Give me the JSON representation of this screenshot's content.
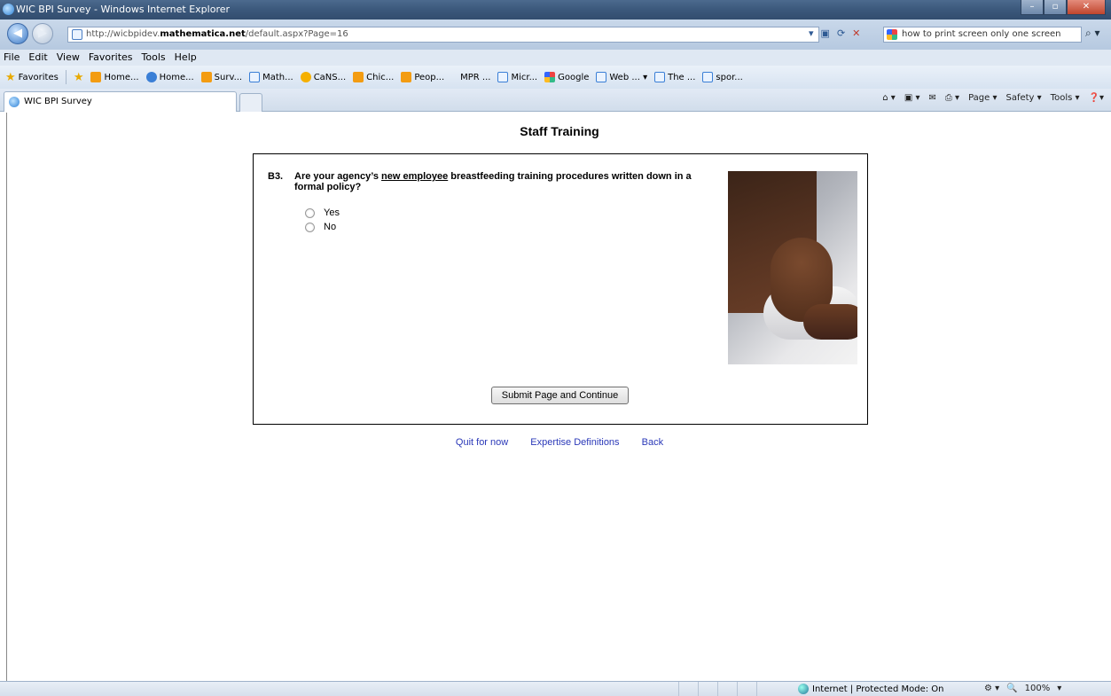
{
  "window": {
    "title": "WIC BPI Survey - Windows Internet Explorer",
    "controls": [
      "–",
      "▫",
      "✕"
    ]
  },
  "address": {
    "url_prefix": "http://wicbpidev.",
    "url_domain": "mathematica.net",
    "url_suffix": "/default.aspx?Page=16",
    "search_value": "how to print screen only one screen"
  },
  "menu": [
    "File",
    "Edit",
    "View",
    "Favorites",
    "Tools",
    "Help"
  ],
  "favorites": {
    "label": "Favorites",
    "items": [
      {
        "label": "Home...",
        "icon": "folder-icon"
      },
      {
        "label": "Home...",
        "icon": "globe-icon"
      },
      {
        "label": "Surv...",
        "icon": "folder-icon"
      },
      {
        "label": "Math...",
        "icon": "ie-page-icon"
      },
      {
        "label": "CaNS...",
        "icon": "ring-icon"
      },
      {
        "label": "Chic...",
        "icon": "folder-icon"
      },
      {
        "label": "Peop...",
        "icon": "folder-icon"
      },
      {
        "label": "MPR ...",
        "icon": "none"
      },
      {
        "label": "Micr...",
        "icon": "ie-page-icon"
      },
      {
        "label": "Google",
        "icon": "google-icon"
      },
      {
        "label": "Web ... ▾",
        "icon": "ie-page-icon"
      },
      {
        "label": "The ...",
        "icon": "ie-page-icon"
      },
      {
        "label": "spor...",
        "icon": "ie-page-icon"
      }
    ]
  },
  "tab": {
    "label": "WIC BPI Survey"
  },
  "commands": [
    "Page ▾",
    "Safety ▾",
    "Tools ▾"
  ],
  "page": {
    "title": "Staff Training",
    "question": {
      "number": "B3.",
      "text_before": "Are your agency’s ",
      "text_underlined": "new employee",
      "text_after": " breastfeeding training procedures written down in a formal policy?",
      "options": [
        "Yes",
        "No"
      ]
    },
    "submit_label": "Submit Page and Continue",
    "links": [
      "Quit for now",
      "Expertise Definitions",
      "Back"
    ]
  },
  "status": {
    "zone": "Internet | Protected Mode: On",
    "zoom": "100%"
  }
}
